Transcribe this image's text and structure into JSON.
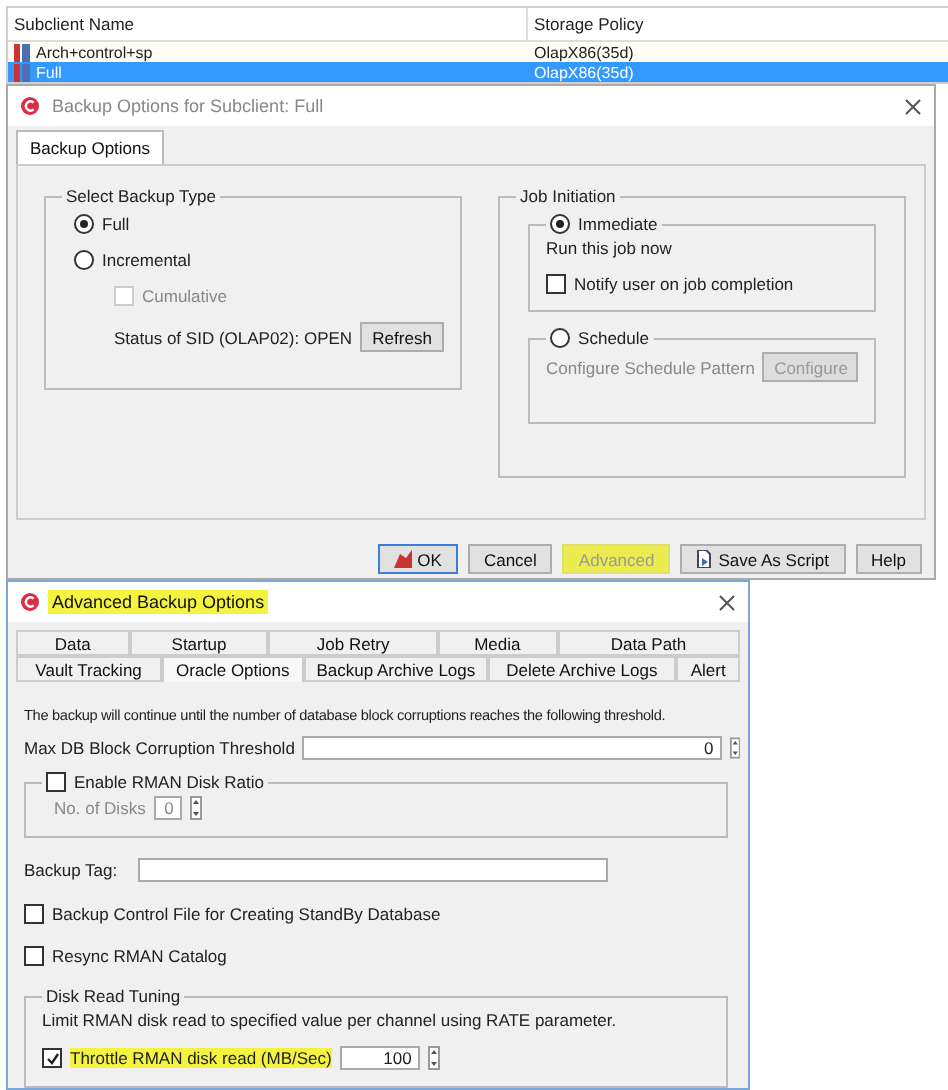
{
  "subclient_table": {
    "columns": [
      "Subclient Name",
      "Storage Policy"
    ],
    "rows": [
      {
        "cells": [
          "Arch+control+sp",
          "OlapX86(35d)"
        ],
        "selected": false
      },
      {
        "cells": [
          "Full",
          "OlapX86(35d)"
        ],
        "selected": true
      }
    ]
  },
  "backup_dialog": {
    "title": "Backup Options for Subclient: Full",
    "tabs": [
      {
        "label": "Backup Options",
        "selected": true
      }
    ],
    "backup_type": {
      "title": "Select Backup Type",
      "options": [
        {
          "label": "Full",
          "selected": true
        },
        {
          "label": "Incremental",
          "selected": false
        }
      ],
      "cumulative": {
        "label": "Cumulative",
        "checked": false,
        "disabled": true
      },
      "status": "Status of SID (OLAP02): OPEN",
      "refresh": "Refresh"
    },
    "job_initiation": {
      "title": "Job Initiation",
      "immediate": {
        "label": "Immediate",
        "selected": true,
        "description": "Run this job now",
        "notify": {
          "label": "Notify user on job completion",
          "checked": false
        }
      },
      "schedule": {
        "label": "Schedule",
        "selected": false,
        "description": "Configure Schedule Pattern",
        "button": "Configure",
        "disabled": true
      }
    },
    "buttons": [
      {
        "label": "OK",
        "kind": "ok",
        "highlighted": false,
        "disabled": false
      },
      {
        "label": "Cancel",
        "kind": "plain",
        "highlighted": false,
        "disabled": false
      },
      {
        "label": "Advanced",
        "kind": "plain",
        "highlighted": true,
        "disabled": true
      },
      {
        "label": "Save As Script",
        "kind": "script",
        "highlighted": false,
        "disabled": false
      },
      {
        "label": "Help",
        "kind": "plain",
        "highlighted": false,
        "disabled": false
      }
    ]
  },
  "advanced_dialog": {
    "title": "Advanced Backup Options",
    "title_highlighted": true,
    "tab_rows": [
      [
        {
          "label": "Data",
          "selected": false
        },
        {
          "label": "Startup",
          "selected": false
        },
        {
          "label": "Job Retry",
          "selected": false
        },
        {
          "label": "Media",
          "selected": false
        },
        {
          "label": "Data Path",
          "selected": false
        }
      ],
      [
        {
          "label": "Vault Tracking",
          "selected": false
        },
        {
          "label": "Oracle Options",
          "selected": true
        },
        {
          "label": "Backup Archive Logs",
          "selected": false
        },
        {
          "label": "Delete Archive Logs",
          "selected": false
        },
        {
          "label": "Alert",
          "selected": false
        }
      ]
    ],
    "intro": "The backup will continue until the number of database block corruptions reaches the following threshold.",
    "threshold": {
      "label": "Max DB Block Corruption Threshold",
      "value": "0"
    },
    "disk_ratio": {
      "label": "Enable RMAN Disk Ratio",
      "checked": false,
      "disks_label": "No. of Disks",
      "disks_value": "0"
    },
    "backup_tag": {
      "label": "Backup Tag:"
    },
    "checkboxes": [
      {
        "label": "Backup Control File for Creating StandBy Database",
        "checked": false
      },
      {
        "label": "Resync RMAN Catalog",
        "checked": false
      }
    ],
    "disk_read": {
      "title": "Disk Read Tuning",
      "description": "Limit RMAN disk read to specified value per channel using RATE parameter.",
      "throttle": {
        "label": "Throttle RMAN disk read (MB/Sec)",
        "checked": true,
        "highlighted": true,
        "value": "100"
      }
    }
  }
}
